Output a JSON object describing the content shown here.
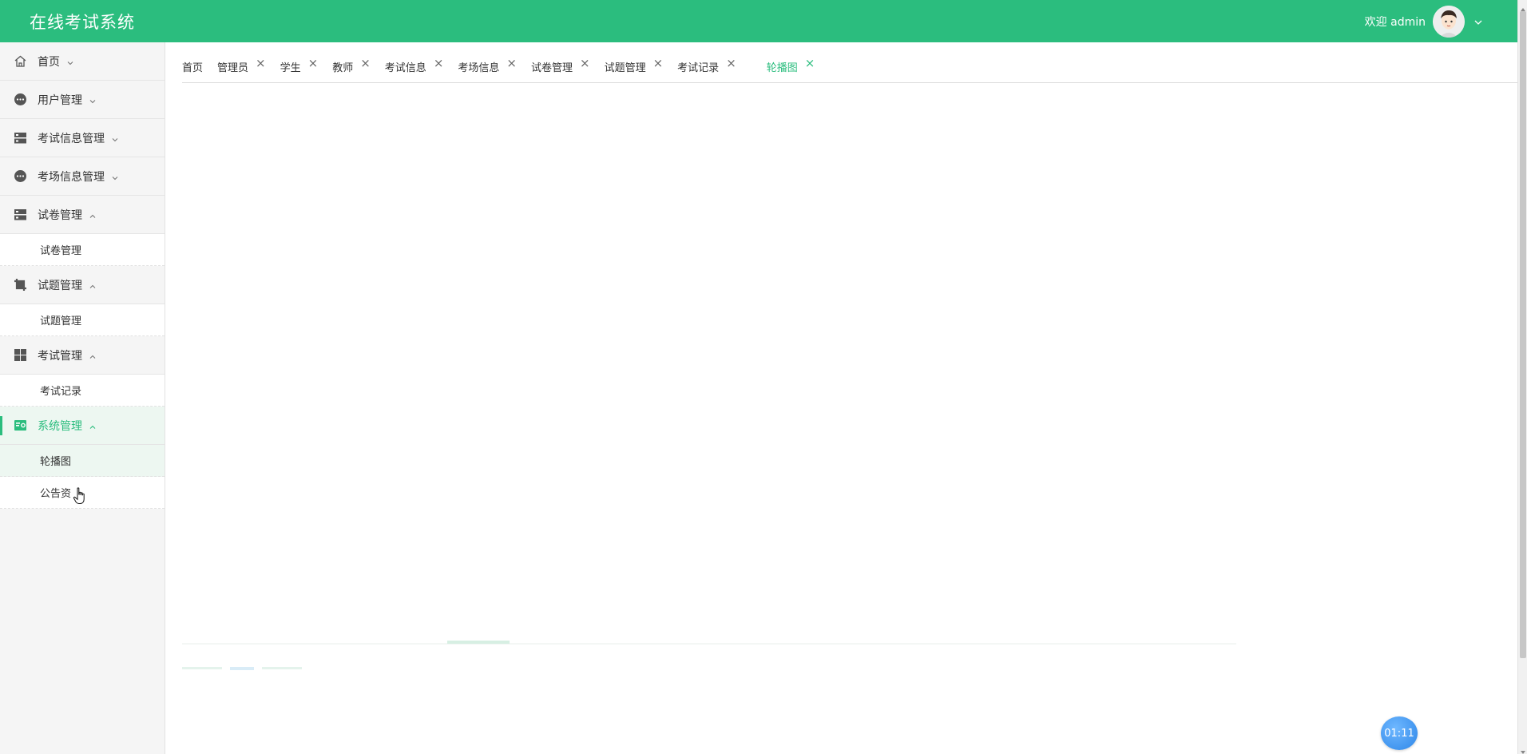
{
  "header": {
    "app_title": "在线考试系统",
    "welcome": "欢迎 admin",
    "bg_color": "#2bbd7e"
  },
  "sidebar": {
    "items": [
      {
        "label": "首页",
        "icon": "home-icon",
        "expanded": false
      },
      {
        "label": "用户管理",
        "icon": "dots-circle-icon",
        "expanded": false
      },
      {
        "label": "考试信息管理",
        "icon": "server-icon",
        "expanded": false
      },
      {
        "label": "考场信息管理",
        "icon": "dots-circle-icon",
        "expanded": false
      },
      {
        "label": "试卷管理",
        "icon": "server-icon",
        "expanded": true,
        "children": [
          "试卷管理"
        ]
      },
      {
        "label": "试题管理",
        "icon": "crop-icon",
        "expanded": true,
        "children": [
          "试题管理"
        ]
      },
      {
        "label": "考试管理",
        "icon": "grid-icon",
        "expanded": true,
        "children": [
          "考试记录"
        ]
      },
      {
        "label": "系统管理",
        "icon": "system-icon",
        "expanded": true,
        "active": true,
        "children": [
          "轮播图",
          "公告资"
        ]
      }
    ]
  },
  "tabs": [
    {
      "label": "首页",
      "closable": false
    },
    {
      "label": "管理员",
      "closable": true
    },
    {
      "label": "学生",
      "closable": true
    },
    {
      "label": "教师",
      "closable": true
    },
    {
      "label": "考试信息",
      "closable": true
    },
    {
      "label": "考场信息",
      "closable": true
    },
    {
      "label": "试卷管理",
      "closable": true
    },
    {
      "label": "试题管理",
      "closable": true
    },
    {
      "label": "考试记录",
      "closable": true
    },
    {
      "label": "轮播图",
      "closable": true,
      "active": true
    }
  ],
  "close_glyph": "×",
  "timer": "01:11",
  "accent_color": "#2bbd7e"
}
